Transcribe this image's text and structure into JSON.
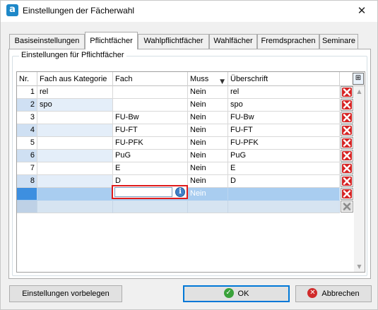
{
  "window": {
    "title": "Einstellungen der Fächerwahl",
    "app_icon": "a",
    "close_glyph": "✕"
  },
  "tabs": [
    {
      "label": "Basiseinstellungen",
      "active": false
    },
    {
      "label": "Pflichtfächer",
      "active": true
    },
    {
      "label": "Wahlpflichtfächer",
      "active": false
    },
    {
      "label": "Wahlfächer",
      "active": false
    },
    {
      "label": "Fremdsprachen",
      "active": false
    },
    {
      "label": "Seminare",
      "active": false
    }
  ],
  "group": {
    "title": "Einstellungen für Pflichtfächer"
  },
  "grid": {
    "columns": {
      "nr": "Nr.",
      "kategorie": "Fach aus Kategorie",
      "fach": "Fach",
      "muss": "Muss",
      "ueberschrift": "Überschrift"
    },
    "rows": [
      {
        "nr": "1",
        "kategorie": "rel",
        "fach": "",
        "muss": "Nein",
        "ueberschrift": "rel"
      },
      {
        "nr": "2",
        "kategorie": "spo",
        "fach": "",
        "muss": "Nein",
        "ueberschrift": "spo"
      },
      {
        "nr": "3",
        "kategorie": "",
        "fach": "FU-Bw",
        "muss": "Nein",
        "ueberschrift": "FU-Bw"
      },
      {
        "nr": "4",
        "kategorie": "",
        "fach": "FU-FT",
        "muss": "Nein",
        "ueberschrift": "FU-FT"
      },
      {
        "nr": "5",
        "kategorie": "",
        "fach": "FU-PFK",
        "muss": "Nein",
        "ueberschrift": "FU-PFK"
      },
      {
        "nr": "6",
        "kategorie": "",
        "fach": "PuG",
        "muss": "Nein",
        "ueberschrift": "PuG"
      },
      {
        "nr": "7",
        "kategorie": "",
        "fach": "E",
        "muss": "Nein",
        "ueberschrift": "E"
      },
      {
        "nr": "8",
        "kategorie": "",
        "fach": "D",
        "muss": "Nein",
        "ueberschrift": "D"
      }
    ],
    "new_row": {
      "muss": "Nein",
      "fach_value": ""
    },
    "sort_glyph": "▼",
    "column_chooser_glyph": "⊞",
    "delete_icon": "delete-icon",
    "info_glyph": "i"
  },
  "buttons": {
    "preset": "Einstellungen vorbelegen",
    "ok": "OK",
    "cancel": "Abbrechen",
    "ok_glyph": "✓",
    "cancel_glyph": "✕"
  },
  "colors": {
    "accent": "#0078d7",
    "selection": "#a9cdf0",
    "highlight_border": "#e01b1b",
    "delete_red": "#d62424"
  }
}
